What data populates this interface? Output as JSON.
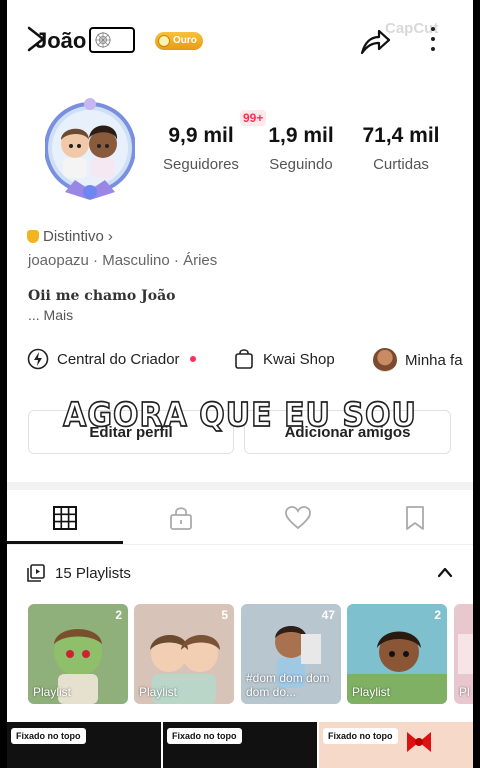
{
  "profile": {
    "name": "João",
    "badge_label": "Ouro",
    "watermark": "CapCut",
    "notification_count": "99+",
    "stats": [
      {
        "value": "9,9 mil",
        "label": "Seguidores"
      },
      {
        "value": "1,9 mil",
        "label": "Seguindo"
      },
      {
        "value": "71,4 mil",
        "label": "Curtidas"
      }
    ],
    "distintivo": "Distintivo",
    "meta": "joaopazu · Masculino · Áries",
    "bio": "Oii me chamo João",
    "more": "... Mais"
  },
  "links": {
    "creator": "Central do Criador",
    "shop": "Kwai Shop",
    "family": "Minha fa"
  },
  "buttons": {
    "edit": "Editar perfil",
    "add_friends": "Adicionar amigos"
  },
  "overlay_subtitle": "AGORA QUE EU SOU",
  "tabs": [
    "grid",
    "lock",
    "heart",
    "bookmark"
  ],
  "playlists": {
    "header": "15 Playlists",
    "cards": [
      {
        "count": "2",
        "caption": "Playlist",
        "color": "#9fb48a"
      },
      {
        "count": "5",
        "caption": "Playlist",
        "color": "#c9a99a"
      },
      {
        "count": "47",
        "caption": "#dom dom dom dom do...",
        "color": "#8fa0a8"
      },
      {
        "count": "2",
        "caption": "Playlist",
        "color": "#7fb9c4"
      },
      {
        "count": "",
        "caption": "Pl",
        "color": "#e9c7cf"
      }
    ]
  },
  "pinned_label": "Fixado no topo",
  "colors": {
    "accent": "#ff2d55",
    "gold": "#f2b51f"
  }
}
